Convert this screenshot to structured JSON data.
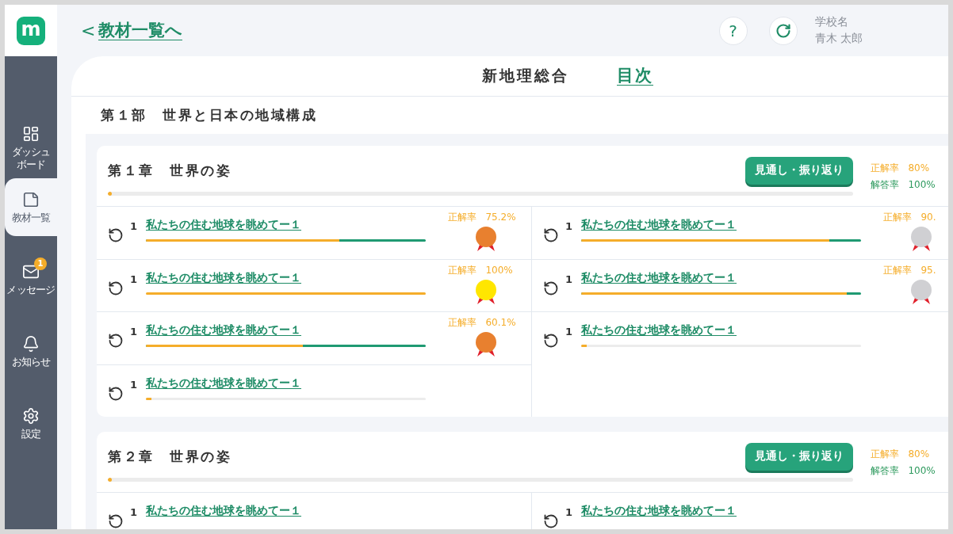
{
  "logo": {
    "letter": "m"
  },
  "sidebar": {
    "items": [
      {
        "kind": "dashboard",
        "label": "ダッシュボード",
        "selected": false
      },
      {
        "kind": "materials",
        "label": "教材一覧",
        "selected": true
      },
      {
        "kind": "messages",
        "label": "メッセージ",
        "selected": false,
        "badge": "1"
      },
      {
        "kind": "notices",
        "label": "お知らせ",
        "selected": false
      },
      {
        "kind": "settings",
        "label": "設定",
        "selected": false
      }
    ]
  },
  "header": {
    "back_link": "教材一覧へ",
    "back_arrow": "<",
    "help": "?",
    "school": "学校名",
    "user": "青木 太郎"
  },
  "page": {
    "subject": "新地理総合",
    "toc_link": "目次"
  },
  "part_title": "第１部　世界と日本の地域構成",
  "chapters": [
    {
      "title": "第１章　世界の姿",
      "button": "見通し・振り返り",
      "level": 0.005,
      "stats": [
        {
          "kind": "correct",
          "label": "正解率",
          "value": "80%"
        },
        {
          "kind": "answered",
          "label": "解答率",
          "value": "100%"
        }
      ],
      "lessons": [
        {
          "number": "1",
          "title": "私たちの住む地球を眺めてー１",
          "level": 0.69,
          "score_label": "正解率",
          "score": "75.2%",
          "color": "#e8802f"
        },
        {
          "number": "1",
          "title": "私たちの住む地球を眺めてー１",
          "level": 0.886,
          "score_label": "正解率",
          "score": "90.",
          "color": "#d0d0d3"
        },
        {
          "number": "1",
          "title": "私たちの住む地球を眺めてー１",
          "level": 1,
          "score_label": "正解率",
          "score": "100%",
          "color": "#ffe600"
        },
        {
          "number": "1",
          "title": "私たちの住む地球を眺めてー１",
          "level": 0.95,
          "score_label": "正解率",
          "score": "95.",
          "color": "#d0d0d3"
        },
        {
          "number": "1",
          "title": "私たちの住む地球を眺めてー１",
          "level": 0.56,
          "score_label": "正解率",
          "score": "60.1%",
          "color": "#e8802f"
        },
        {
          "number": "1",
          "title": "私たちの住む地球を眺めてー１",
          "level": 0.02
        },
        {
          "number": "1",
          "title": "私たちの住む地球を眺めてー１",
          "level": 0.02
        }
      ]
    },
    {
      "title": "第２章　世界の姿",
      "button": "見通し・振り返り",
      "level": 0.005,
      "stats": [
        {
          "kind": "correct",
          "label": "正解率",
          "value": "80%"
        },
        {
          "kind": "answered",
          "label": "解答率",
          "value": "100%"
        }
      ],
      "lessons": [
        {
          "number": "1",
          "title": "私たちの住む地球を眺めてー１"
        },
        {
          "number": "1",
          "title": "私たちの住む地球を眺めてー１"
        }
      ]
    }
  ]
}
